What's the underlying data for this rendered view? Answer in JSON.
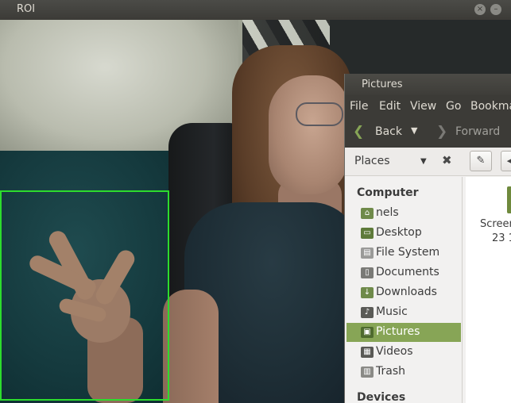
{
  "roi_window": {
    "title": "ROI",
    "close_glyph": "×",
    "minimize_glyph": "–",
    "box_color": "#2ddc2d"
  },
  "file_manager": {
    "title": "Pictures",
    "menu": [
      "File",
      "Edit",
      "View",
      "Go",
      "Bookma"
    ],
    "toolbar": {
      "back_label": "Back",
      "back_arrow": "❮",
      "back_dropdown": "▼",
      "forward_label": "Forward",
      "forward_arrow": "❯"
    },
    "places_bar": {
      "label": "Places",
      "dropdown": "▼",
      "close": "✖",
      "edit_icon": "✎",
      "left_icon": "◀"
    },
    "sidebar": {
      "heading": "Computer",
      "items": [
        {
          "label": "nels",
          "icon": "home-folder-icon"
        },
        {
          "label": "Desktop",
          "icon": "desktop-icon"
        },
        {
          "label": "File System",
          "icon": "drive-icon"
        },
        {
          "label": "Documents",
          "icon": "documents-folder-icon"
        },
        {
          "label": "Downloads",
          "icon": "downloads-folder-icon"
        },
        {
          "label": "Music",
          "icon": "music-folder-icon"
        },
        {
          "label": "Pictures",
          "icon": "pictures-folder-icon",
          "selected": true
        },
        {
          "label": "Videos",
          "icon": "videos-folder-icon"
        },
        {
          "label": "Trash",
          "icon": "trash-icon"
        }
      ],
      "devices_heading": "Devices"
    },
    "content": {
      "file_name_line1": "Screen",
      "file_name_line2": "23 1"
    },
    "accent_color": "#87a556"
  }
}
